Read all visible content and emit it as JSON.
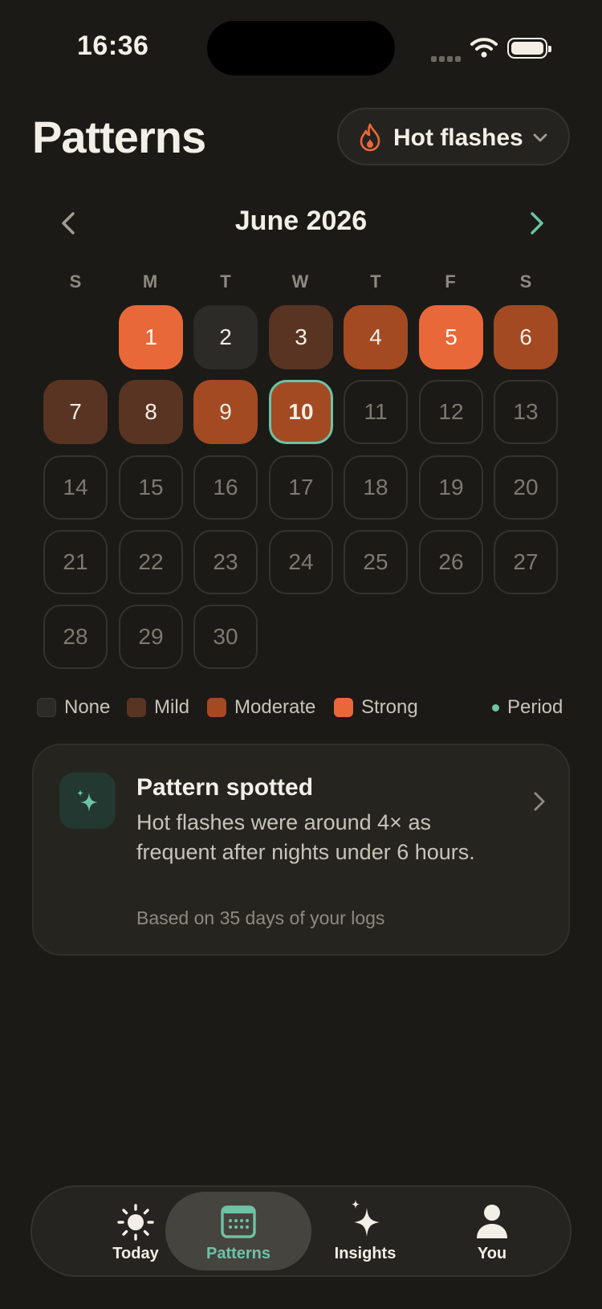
{
  "status": {
    "time": "16:36"
  },
  "header": {
    "title": "Patterns",
    "symptom_label": "Hot flashes"
  },
  "calendar": {
    "month_label": "June 2026",
    "weekdays": [
      "S",
      "M",
      "T",
      "W",
      "T",
      "F",
      "S"
    ],
    "first_weekday_index": 1,
    "days": [
      {
        "day": "1",
        "level": "strong"
      },
      {
        "day": "2",
        "level": "none"
      },
      {
        "day": "3",
        "level": "mild"
      },
      {
        "day": "4",
        "level": "moderate"
      },
      {
        "day": "5",
        "level": "strong"
      },
      {
        "day": "6",
        "level": "moderate"
      },
      {
        "day": "7",
        "level": "mild"
      },
      {
        "day": "8",
        "level": "mild"
      },
      {
        "day": "9",
        "level": "moderate"
      },
      {
        "day": "10",
        "level": "moderate",
        "today": true
      },
      {
        "day": "11",
        "level": "future"
      },
      {
        "day": "12",
        "level": "future"
      },
      {
        "day": "13",
        "level": "future"
      },
      {
        "day": "14",
        "level": "future"
      },
      {
        "day": "15",
        "level": "future"
      },
      {
        "day": "16",
        "level": "future"
      },
      {
        "day": "17",
        "level": "future"
      },
      {
        "day": "18",
        "level": "future"
      },
      {
        "day": "19",
        "level": "future"
      },
      {
        "day": "20",
        "level": "future"
      },
      {
        "day": "21",
        "level": "future"
      },
      {
        "day": "22",
        "level": "future"
      },
      {
        "day": "23",
        "level": "future"
      },
      {
        "day": "24",
        "level": "future"
      },
      {
        "day": "25",
        "level": "future"
      },
      {
        "day": "26",
        "level": "future"
      },
      {
        "day": "27",
        "level": "future"
      },
      {
        "day": "28",
        "level": "future"
      },
      {
        "day": "29",
        "level": "future"
      },
      {
        "day": "30",
        "level": "future"
      }
    ]
  },
  "legend": {
    "none": "None",
    "mild": "Mild",
    "moderate": "Moderate",
    "strong": "Strong",
    "period": "Period"
  },
  "colors": {
    "none": "#2c2b27",
    "mild": "#5a3423",
    "moderate": "#a34a23",
    "strong": "#e8683a",
    "accent": "#6cc3a5"
  },
  "insight": {
    "heading": "Pattern spotted",
    "body": "Hot flashes were around 4× as frequent after nights under 6 hours.",
    "footnote": "Based on 35 days of your logs"
  },
  "tabs": [
    {
      "label": "Today",
      "icon": "sun-icon"
    },
    {
      "label": "Patterns",
      "icon": "calendar-icon",
      "active": true
    },
    {
      "label": "Insights",
      "icon": "sparkle-icon"
    },
    {
      "label": "You",
      "icon": "person-icon"
    }
  ]
}
